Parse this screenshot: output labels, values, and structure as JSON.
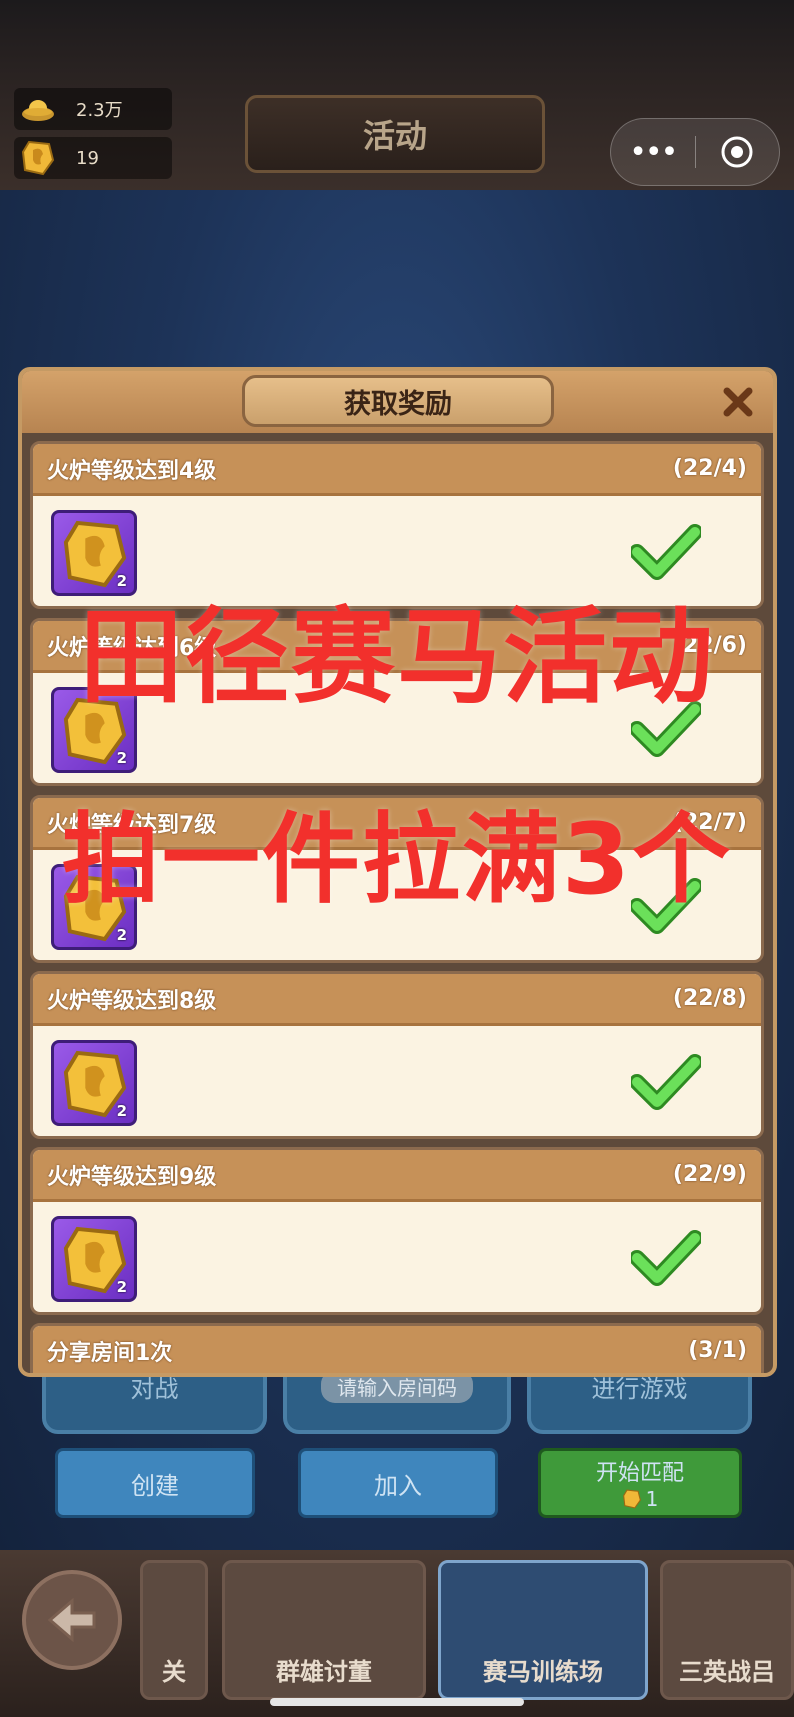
{
  "status": {
    "gold_value": "2.3万",
    "ticket_value": "19"
  },
  "header": {
    "title": "活动"
  },
  "modal": {
    "title": "获取奖励",
    "tasks": [
      {
        "name": "火炉等级达到4级",
        "progress": "(22/4)",
        "reward_qty": "2",
        "completed": true
      },
      {
        "name": "火炉等级达到6级",
        "progress": "(22/6)",
        "reward_qty": "2",
        "completed": true
      },
      {
        "name": "火炉等级达到7级",
        "progress": "(22/7)",
        "reward_qty": "2",
        "completed": true
      },
      {
        "name": "火炉等级达到8级",
        "progress": "(22/8)",
        "reward_qty": "2",
        "completed": true
      },
      {
        "name": "火炉等级达到9级",
        "progress": "(22/9)",
        "reward_qty": "2",
        "completed": true
      },
      {
        "name": "分享房间1次",
        "progress": "(3/1)",
        "reward_qty": "",
        "completed": true
      }
    ]
  },
  "background": {
    "row_labels": [
      "对战",
      "请输入房间码",
      "进行游戏"
    ],
    "create_label": "创建",
    "join_label": "加入",
    "match_label": "开始匹配",
    "match_cost": "1"
  },
  "tabs": [
    {
      "label": "关"
    },
    {
      "label": "群雄讨董"
    },
    {
      "label": "赛马训练场"
    },
    {
      "label": "三英战吕"
    }
  ],
  "overlay": {
    "line1": "田径赛马活动",
    "line2": "拍一件拉满3个"
  },
  "colors": {
    "overlay_red": "#f2302c",
    "check_green": "#5ed34a",
    "reward_purple": "#8a45dd",
    "header_tan": "#c69158"
  }
}
